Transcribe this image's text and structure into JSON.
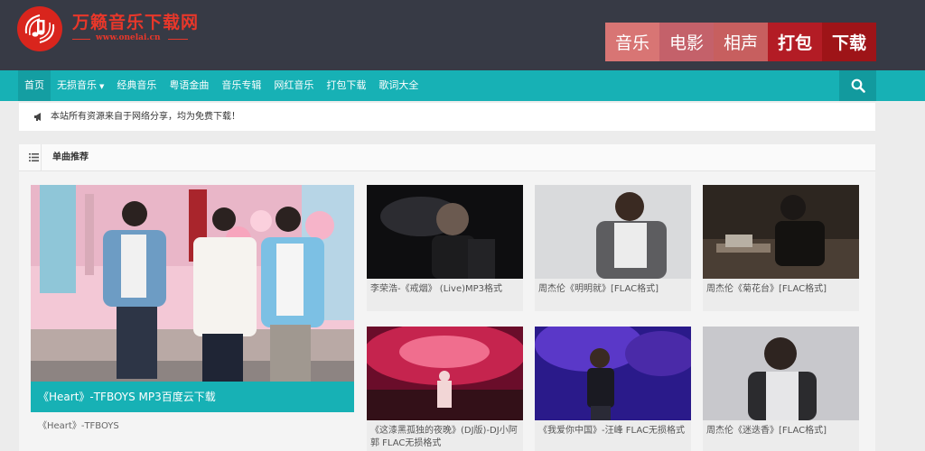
{
  "site": {
    "title": "万籁音乐下载网",
    "url": "www.onelai.cn"
  },
  "categories": [
    "音乐",
    "电影",
    "相声",
    "打包",
    "下载"
  ],
  "nav": {
    "items": [
      "首页",
      "无损音乐",
      "经典音乐",
      "粤语金曲",
      "音乐专辑",
      "网红音乐",
      "打包下载",
      "歌词大全"
    ],
    "active_index": 0,
    "search_icon": "search-icon"
  },
  "notice": {
    "text": "本站所有资源来自于网络分享，均为免费下载！"
  },
  "section": {
    "title": "单曲推荐"
  },
  "featured": {
    "title": "《Heart》-TFBOYS MP3百度云下载",
    "subtitle": "《Heart》-TFBOYS"
  },
  "cards": [
    {
      "title": "李荣浩-《戒烟》 (Live)MP3格式"
    },
    {
      "title": "周杰伦《明明就》[FLAC格式]"
    },
    {
      "title": "周杰伦《菊花台》[FLAC格式]"
    },
    {
      "title": "《这漆黑孤独的夜晚》(DJ版)-DJ小阿郭 FLAC无损格式"
    },
    {
      "title": "《我爱你中国》-汪峰 FLAC无损格式"
    },
    {
      "title": "周杰伦《迷迭香》[FLAC格式]"
    }
  ],
  "colors": {
    "header_bg": "#373a45",
    "nav_bg": "#17b1b5",
    "logo_red": "#d9251d"
  }
}
